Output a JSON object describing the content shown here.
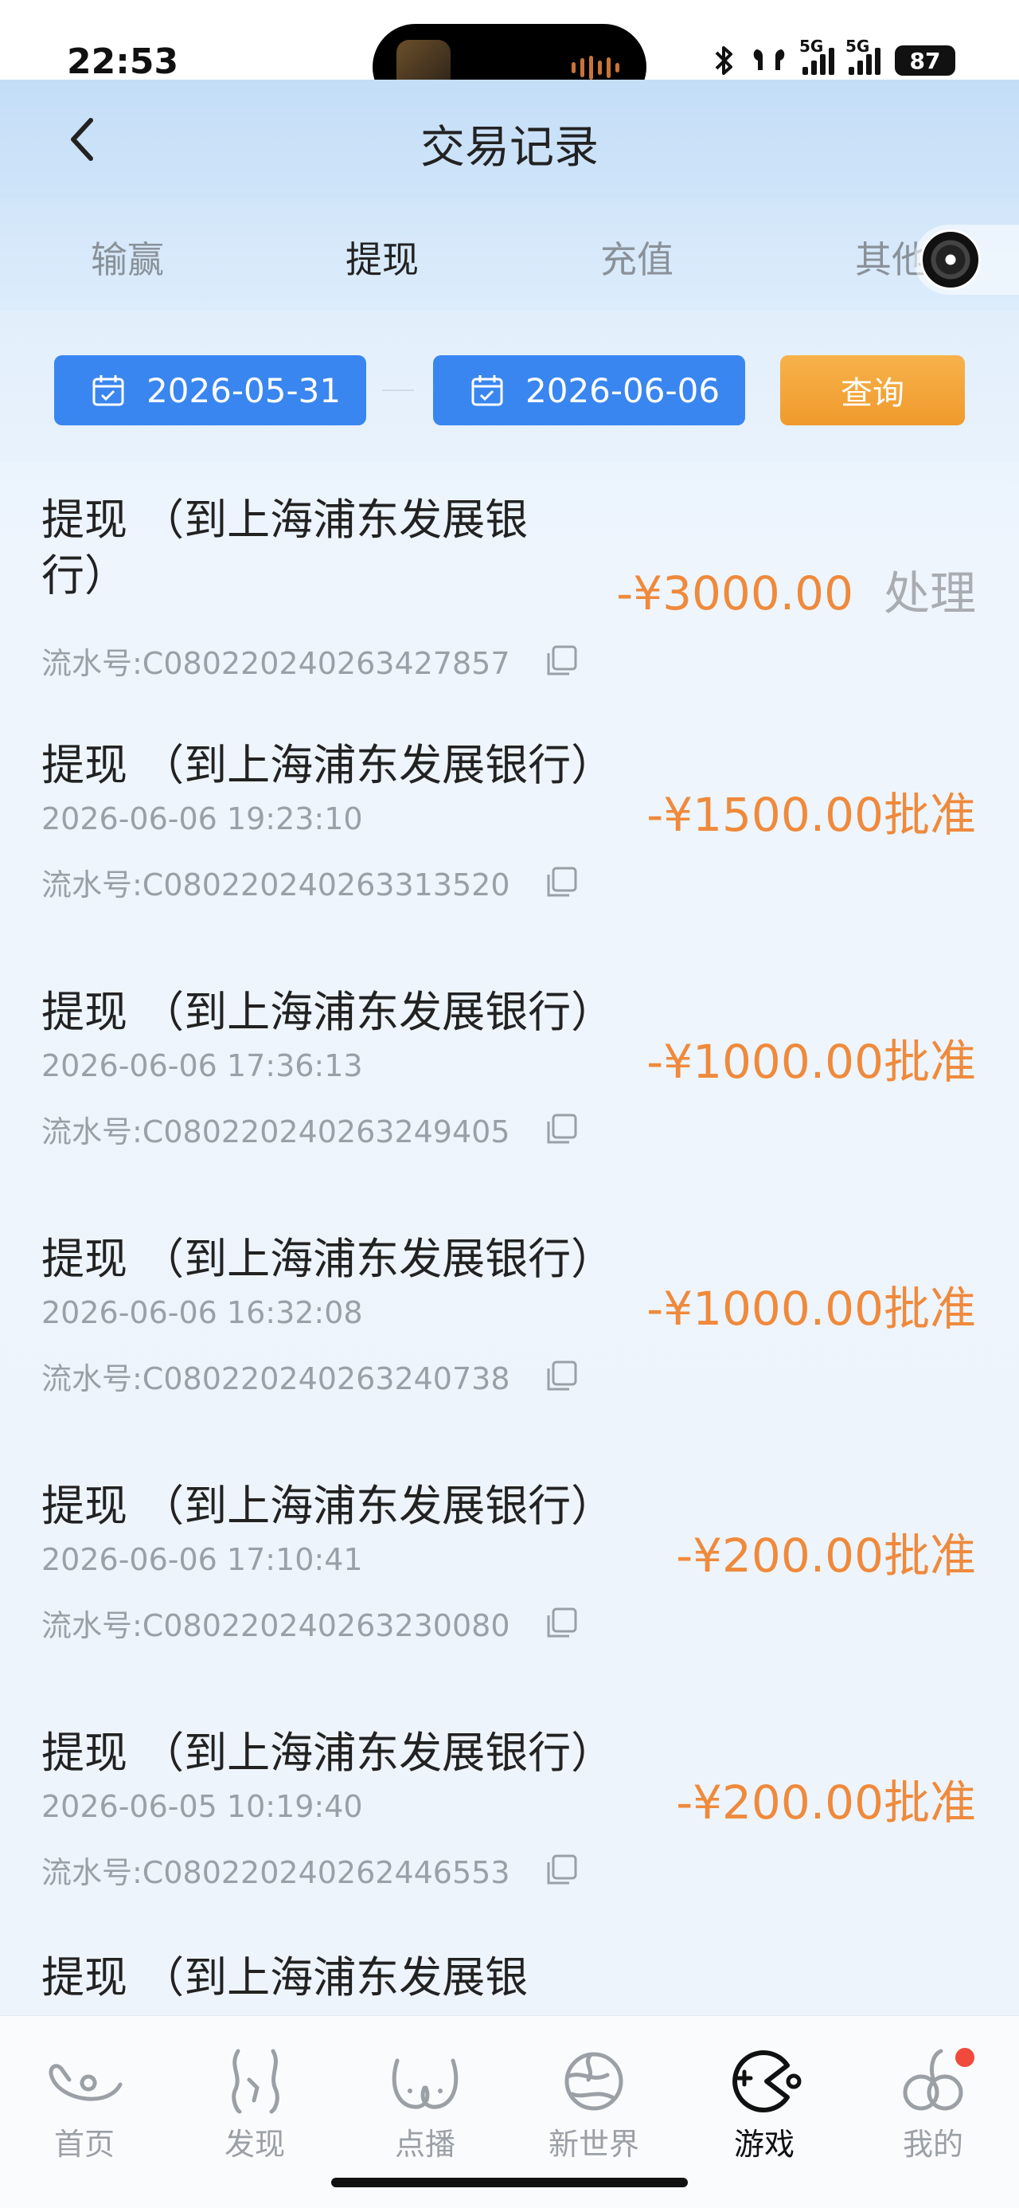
{
  "status_bar": {
    "time": "22:53",
    "signal_1": "5G",
    "signal_2": "5G",
    "battery": "87"
  },
  "header": {
    "title": "交易记录"
  },
  "tabs": [
    {
      "label": "输赢",
      "active": false
    },
    {
      "label": "提现",
      "active": true
    },
    {
      "label": "充值",
      "active": false
    },
    {
      "label": "其他",
      "active": false
    }
  ],
  "filter": {
    "start_date": "2026-05-31",
    "end_date": "2026-06-06",
    "query_label": "查询"
  },
  "records": [
    {
      "title_line1": "提现 （到上海浦东发展银",
      "title_line2": "行）",
      "date": "",
      "serial": "流水号:C080220240263427857",
      "amount": "-¥3000.00",
      "status": "处理"
    },
    {
      "title_line1": "提现 （到上海浦东发展银行）",
      "title_line2": "",
      "date": "2026-06-06 19:23:10",
      "serial": "流水号:C080220240263313520",
      "amount": "-¥1500.00",
      "status": "批准"
    },
    {
      "title_line1": "提现 （到上海浦东发展银行）",
      "title_line2": "",
      "date": "2026-06-06 17:36:13",
      "serial": "流水号:C080220240263249405",
      "amount": "-¥1000.00",
      "status": "批准"
    },
    {
      "title_line1": "提现 （到上海浦东发展银行）",
      "title_line2": "",
      "date": "2026-06-06 16:32:08",
      "serial": "流水号:C080220240263240738",
      "amount": "-¥1000.00",
      "status": "批准"
    },
    {
      "title_line1": "提现 （到上海浦东发展银行）",
      "title_line2": "",
      "date": "2026-06-06 17:10:41",
      "serial": "流水号:C080220240263230080",
      "amount": "-¥200.00",
      "status": "批准"
    },
    {
      "title_line1": "提现 （到上海浦东发展银行）",
      "title_line2": "",
      "date": "2026-06-05 10:19:40",
      "serial": "流水号:C080220240262446553",
      "amount": "-¥200.00",
      "status": "批准"
    },
    {
      "title_line1": "提现 （到上海浦东发展银",
      "title_line2": "",
      "date": "",
      "serial": "",
      "amount": "",
      "status": ""
    }
  ],
  "bottom_nav": [
    {
      "label": "首页",
      "icon": "home-icon",
      "active": false
    },
    {
      "label": "发现",
      "icon": "discover-icon",
      "active": false
    },
    {
      "label": "点播",
      "icon": "vod-icon",
      "active": false
    },
    {
      "label": "新世界",
      "icon": "new-world-icon",
      "active": false
    },
    {
      "label": "游戏",
      "icon": "game-icon",
      "active": true
    },
    {
      "label": "我的",
      "icon": "profile-icon",
      "active": false,
      "badge": true
    }
  ],
  "colors": {
    "accent_blue": "#3a86f0",
    "accent_orange": "#f09a2c",
    "amount_orange": "#ef8a3c",
    "pending_gray": "#a9adb2"
  }
}
